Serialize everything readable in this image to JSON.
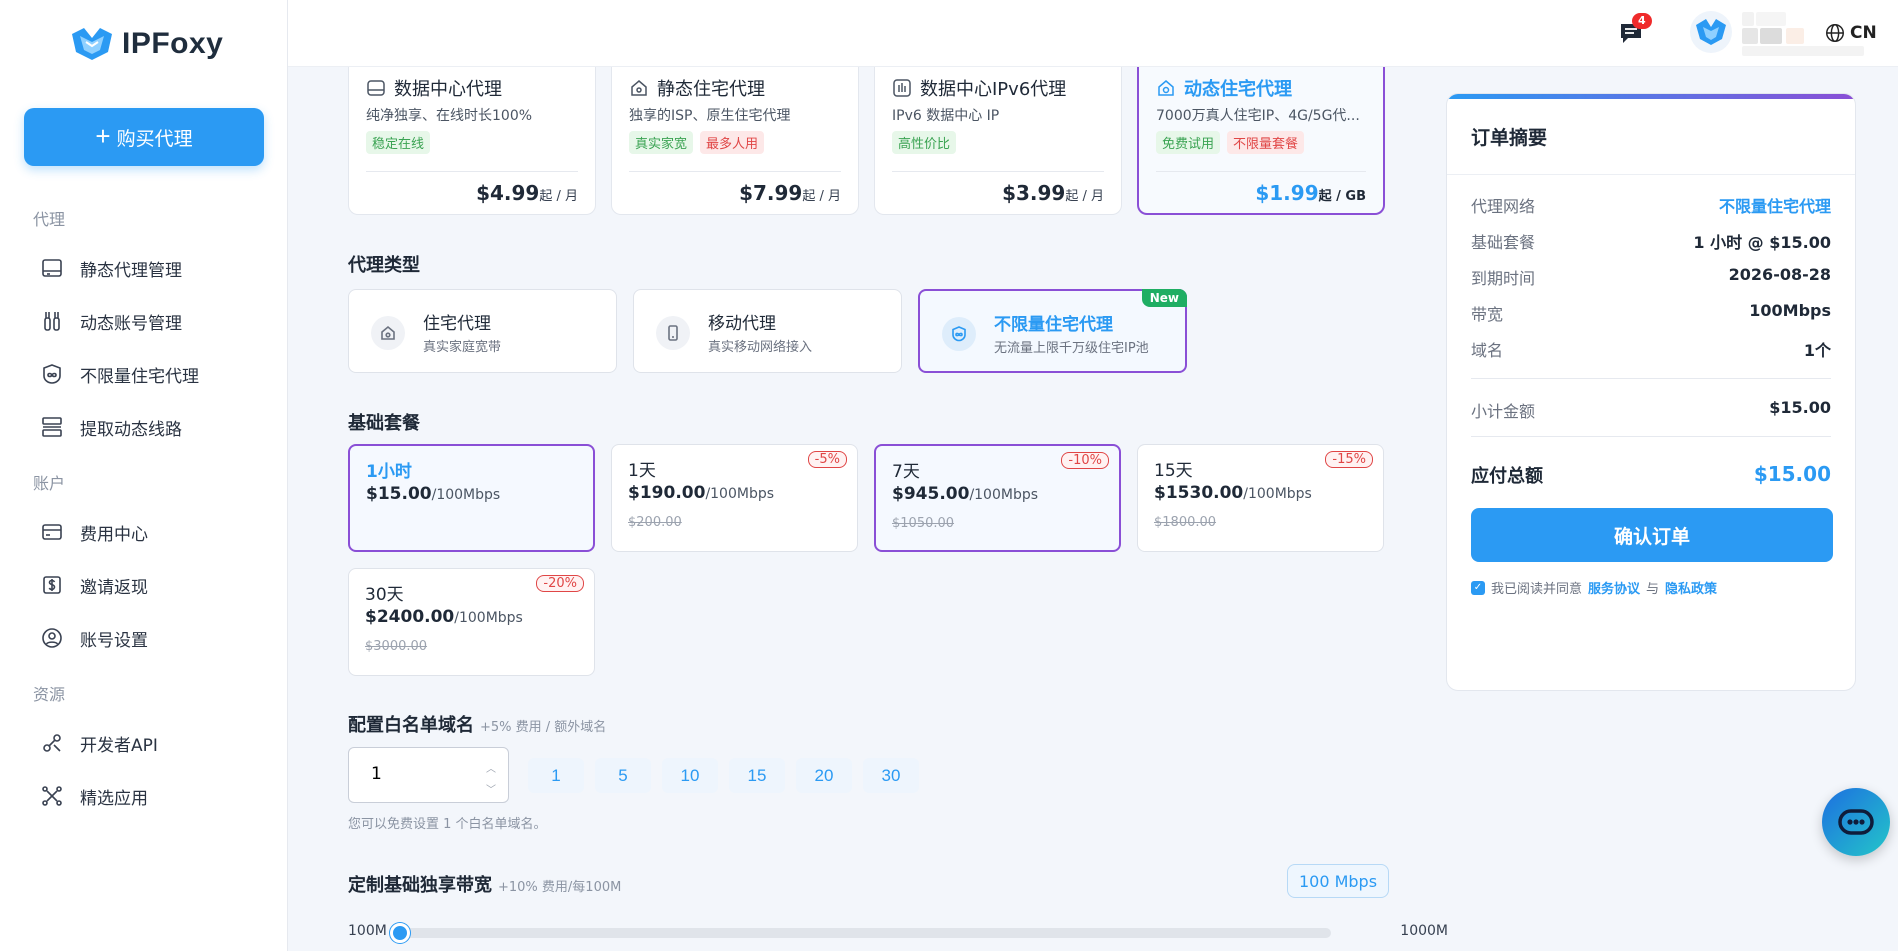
{
  "brand": {
    "name": "IPFoxy"
  },
  "sidebar": {
    "buy_label": "购买代理",
    "sections": [
      {
        "label": "代理",
        "items": [
          {
            "label": "静态代理管理"
          },
          {
            "label": "动态账号管理"
          },
          {
            "label": "不限量住宅代理"
          },
          {
            "label": "提取动态线路"
          }
        ]
      },
      {
        "label": "账户",
        "items": [
          {
            "label": "费用中心"
          },
          {
            "label": "邀请返现"
          },
          {
            "label": "账号设置"
          }
        ]
      },
      {
        "label": "资源",
        "items": [
          {
            "label": "开发者API"
          },
          {
            "label": "精选应用"
          }
        ]
      }
    ]
  },
  "header": {
    "language": "CN",
    "message_count": "4"
  },
  "plans": [
    {
      "title": "数据中心代理",
      "desc": "纯净独享、在线时长100%",
      "tags": [
        {
          "text": "稳定在线",
          "color": "green"
        }
      ],
      "price": "$4.99",
      "unit": "起 / 月",
      "active": false
    },
    {
      "title": "静态住宅代理",
      "desc": "独享的ISP、原生住宅代理",
      "tags": [
        {
          "text": "真实家宽",
          "color": "green"
        },
        {
          "text": "最多人用",
          "color": "red"
        }
      ],
      "price": "$7.99",
      "unit": "起 / 月",
      "active": false
    },
    {
      "title": "数据中心IPv6代理",
      "desc": "IPv6 数据中心 IP",
      "tags": [
        {
          "text": "高性价比",
          "color": "green"
        }
      ],
      "price": "$3.99",
      "unit": "起 / 月",
      "active": false
    },
    {
      "title": "动态住宅代理",
      "desc": "7000万真人住宅IP、4G/5G代...",
      "tags": [
        {
          "text": "免费试用",
          "color": "green"
        },
        {
          "text": "不限量套餐",
          "color": "red"
        }
      ],
      "price": "$1.99",
      "unit": "起 / GB",
      "active": true
    }
  ],
  "proxy_type": {
    "title": "代理类型",
    "options": [
      {
        "name": "住宅代理",
        "sub": "真实家庭宽带",
        "active": false
      },
      {
        "name": "移动代理",
        "sub": "真实移动网络接入",
        "active": false
      },
      {
        "name": "不限量住宅代理",
        "sub": "无流量上限千万级住宅IP池",
        "active": true,
        "badge": "New"
      }
    ]
  },
  "packages": {
    "title": "基础套餐",
    "items": [
      {
        "dur": "1小时",
        "price": "$15.00",
        "unit": "/100Mbps",
        "old": "",
        "disc": ""
      },
      {
        "dur": "1天",
        "price": "$190.00",
        "unit": "/100Mbps",
        "old": "$200.00",
        "disc": "-5%"
      },
      {
        "dur": "7天",
        "price": "$945.00",
        "unit": "/100Mbps",
        "old": "$1050.00",
        "disc": "-10%"
      },
      {
        "dur": "15天",
        "price": "$1530.00",
        "unit": "/100Mbps",
        "old": "$1800.00",
        "disc": "-15%"
      },
      {
        "dur": "30天",
        "price": "$2400.00",
        "unit": "/100Mbps",
        "old": "$3000.00",
        "disc": "-20%"
      }
    ]
  },
  "whitelist": {
    "title": "配置白名单域名",
    "hint": "+5% 费用 / 额外域名",
    "value": "1",
    "chips": [
      "1",
      "5",
      "10",
      "15",
      "20",
      "30"
    ],
    "help": "您可以免费设置 1 个白名单域名。"
  },
  "bandwidth": {
    "title": "定制基础独享带宽",
    "hint": "+10% 费用/每100M",
    "value": "100 Mbps",
    "min": "100M",
    "max": "1000M",
    "level": 0
  },
  "summary": {
    "title": "订单摘要",
    "rows": [
      {
        "k": "代理网络",
        "v": "不限量住宅代理"
      },
      {
        "k": "基础套餐",
        "v": "1 小时 @ $15.00"
      },
      {
        "k": "到期时间",
        "v": "2026-08-28"
      },
      {
        "k": "带宽",
        "v": "100Mbps"
      },
      {
        "k": "域名",
        "v": "1个"
      }
    ],
    "subtotal_label": "小计金额",
    "subtotal": "$15.00",
    "total_label": "应付总额",
    "total": "$15.00",
    "confirm": "确认订单",
    "agree_text": "我已阅读并同意",
    "terms": "服务协议",
    "and": "与",
    "privacy": "隐私政策"
  },
  "colors": {
    "accent": "#2b9af3",
    "active_border": "#8a4fd6",
    "tag_green": "#3aa352",
    "tag_red": "#e04646"
  }
}
